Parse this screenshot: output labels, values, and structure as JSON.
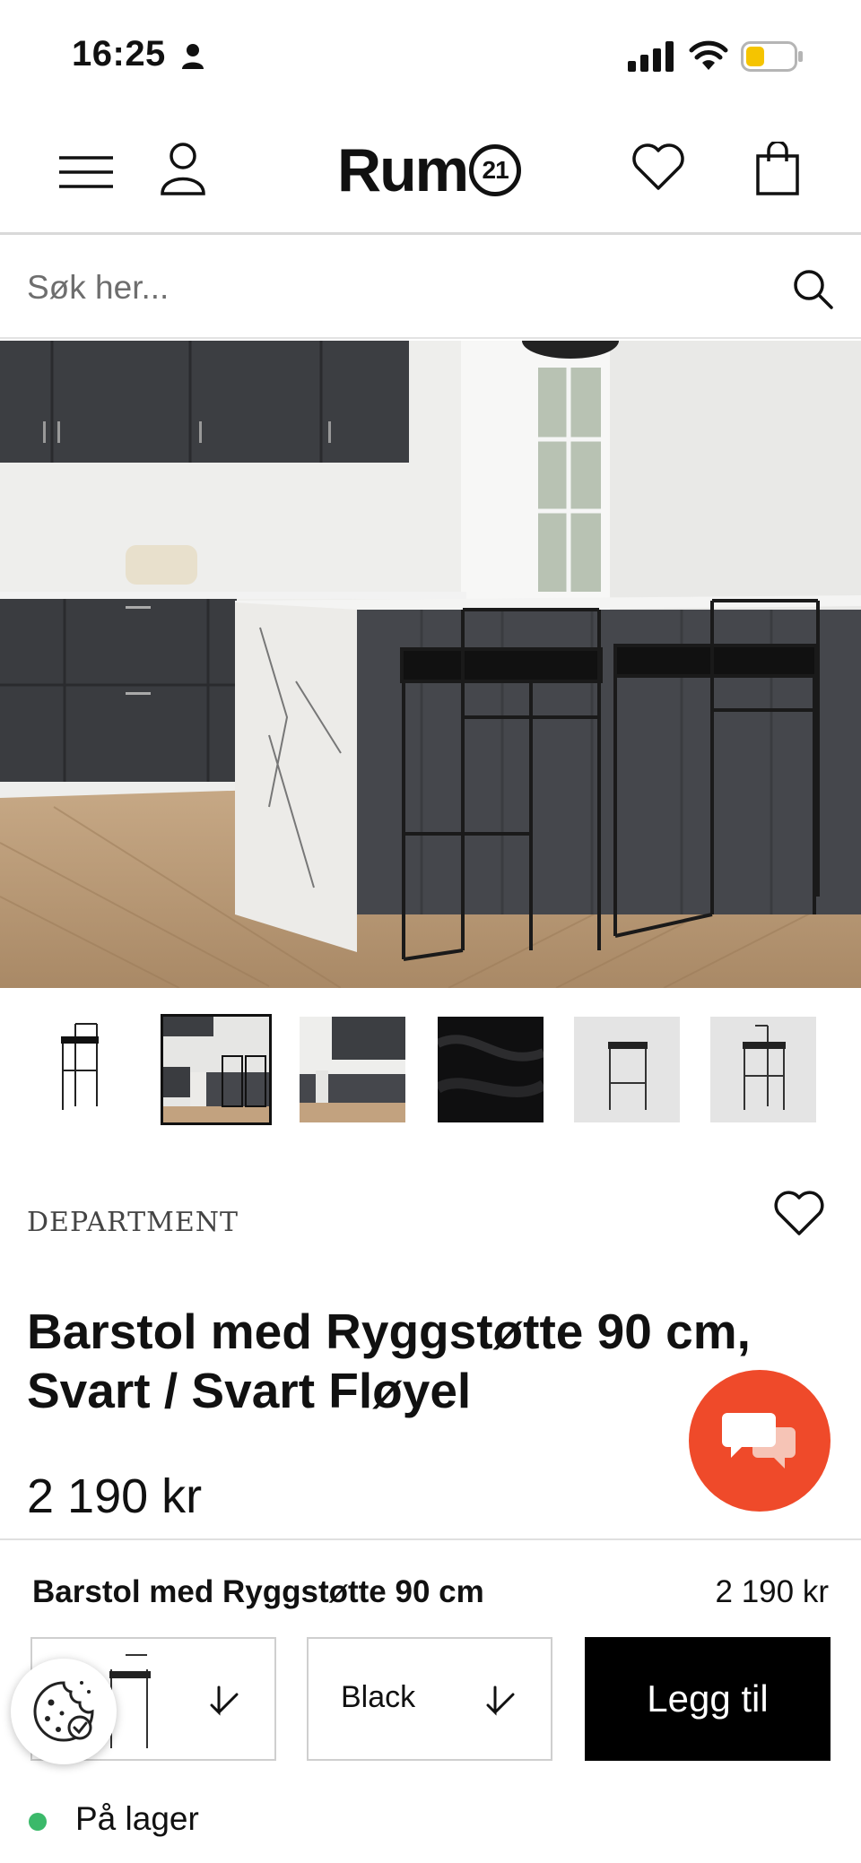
{
  "status_bar": {
    "time": "16:25",
    "icons": [
      "person-icon",
      "cellular-signal-icon",
      "wifi-icon",
      "battery-icon"
    ],
    "battery_color": "#f5c400"
  },
  "header": {
    "logo_text": "Rum",
    "logo_mark": "21",
    "icons": [
      "menu-icon",
      "account-icon",
      "heart-icon",
      "shopping-bag-icon"
    ]
  },
  "search": {
    "placeholder": "Søk her...",
    "icon": "search-icon"
  },
  "gallery": {
    "thumbnail_count": 6,
    "selected_index": 1
  },
  "product": {
    "brand": "DEPARTMENT",
    "title": "Barstol med Ryggstøtte 90 cm, Svart / Svart Fløyel",
    "price": "2 190 kr"
  },
  "buy_bar": {
    "name": "Barstol med Ryggstøtte 90 cm",
    "price": "2 190 kr",
    "color_value": "Black",
    "add_label": "Legg til",
    "stock_text": "På lager",
    "stock_color": "#3bb96a"
  },
  "colors": {
    "chat_button": "#ef4a2a",
    "add_button": "#000000"
  }
}
